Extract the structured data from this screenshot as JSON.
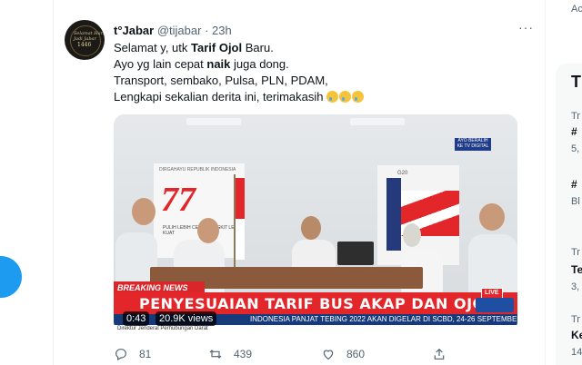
{
  "tweet": {
    "display_name": "t°Jabar",
    "handle": "@tijabar",
    "dot": "·",
    "time": "23h",
    "more": "···",
    "avatar_text_1": "Selamat Hari Jadi Jabar",
    "avatar_text_2": "1446",
    "text": {
      "l1_a": "Selamat y, utk ",
      "l1_b": "Tarif Ojol",
      "l1_c": " Baru.",
      "l2_a": "Ayo yg lain cepat ",
      "l2_b": "naik",
      "l2_c": " juga dong.",
      "l3": "Transport, sembako, Pulsa, PLN, PDAM,",
      "l4": "Lengkapi sekalian derita ini, terimakasih"
    },
    "media": {
      "breaking_label": "BREAKING NEWS",
      "headline": "PENYESUAIAN TARIF BUS AKAP DAN OJOL",
      "live_label": "LIVE",
      "ticker": "INDONESIA PANJAT TEBING 2022 AKAN DIGELAR DI SCBD, 24-26 SEPTEMBER",
      "ticker_sub": "Direktur Jenderal Perhubungan Darat",
      "banner_top": "DIRGAHAYU REPUBLIK INDONESIA",
      "banner_number": "77",
      "banner_bottom": "PULIH LEBIH CEPAT BANGKIT LEBIH KUAT",
      "sign_text": "AYO BERALIH KE TV DIGITAL",
      "logo_text": "G20",
      "duration": "0:43",
      "views": "20.9K views"
    },
    "actions": {
      "replies": "81",
      "retweets": "439",
      "likes": "860"
    }
  },
  "sidebar": {
    "top_fragment": "Ac",
    "trends": [
      {
        "meta": "Tr",
        "title": "#",
        "count": "5,"
      },
      {
        "meta": "",
        "title": "#",
        "count": "Bl"
      },
      {
        "meta": "Tr",
        "title": "Te",
        "count": "3,"
      },
      {
        "meta": "Tr",
        "title": "Ke",
        "count": "14"
      }
    ],
    "section_fragment": "T"
  },
  "colors": {
    "accent": "#1d9bf0",
    "headline_red": "#e3262a",
    "ticker_blue": "#173b7a",
    "muted": "#536471"
  }
}
